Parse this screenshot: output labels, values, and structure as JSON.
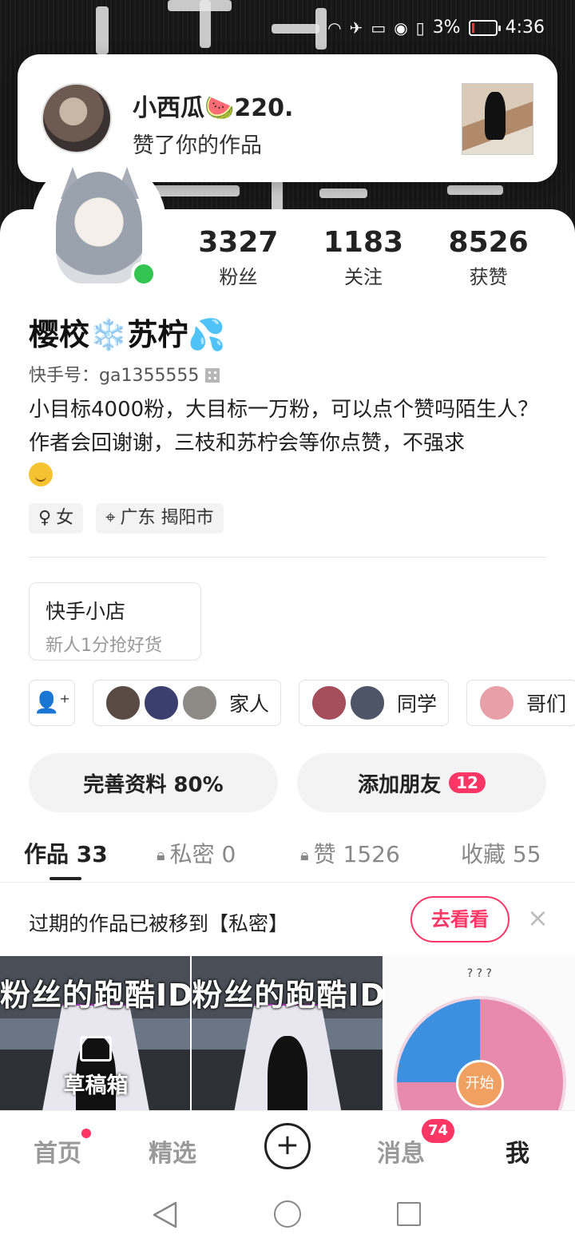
{
  "status": {
    "battery_percent": "3%",
    "time": "4:36"
  },
  "notification": {
    "user_name": "小西瓜🍉220.",
    "action": "赞了你的作品"
  },
  "stats": [
    {
      "value": "3327",
      "label": "粉丝"
    },
    {
      "value": "1183",
      "label": "关注"
    },
    {
      "value": "8526",
      "label": "获赞"
    }
  ],
  "profile": {
    "nickname": "樱校❄️苏柠💦",
    "kuaishou_id": "快手号：ga1355555",
    "bio": "小目标4000粉，大目标一万粉，可以点个赞吗陌生人？作者会回谢谢，三枝和苏柠会等你点赞，不强求",
    "tags": [
      {
        "icon": "female-icon",
        "text": "女"
      },
      {
        "icon": "location-icon",
        "text": "广东 揭阳市"
      }
    ]
  },
  "shop": {
    "title": "快手小店",
    "subtitle": "新人1分抢好货"
  },
  "groups": [
    {
      "label": "家人",
      "avatars": [
        "#5a4a44",
        "#3b3f6e",
        "#8d8a86"
      ]
    },
    {
      "label": "同学",
      "avatars": [
        "#a64d5c",
        "#4d5566"
      ]
    },
    {
      "label": "哥们",
      "avatars": [
        "#e8a0a8"
      ]
    }
  ],
  "buttons": {
    "complete_profile": "完善资料 80%",
    "add_friends": "添加朋友",
    "add_friends_badge": "12"
  },
  "tabs": {
    "works": "作品 33",
    "private": "私密 0",
    "likes": "赞 1526",
    "favorites": "收藏 55"
  },
  "notice": {
    "text": "过期的作品已被移到【私密】",
    "button": "去看看",
    "close": "×"
  },
  "grid": {
    "caption": "粉丝的跑酷ID在",
    "draft_label": "草稿箱",
    "wheel_title": "? ? ?",
    "wheel_button": "开始"
  },
  "bottom_nav": {
    "home": "首页",
    "featured": "精选",
    "plus": "+",
    "messages": "消息",
    "messages_badge": "74",
    "me": "我"
  },
  "colors": {
    "accent": "#fe3666",
    "online": "#33c451"
  }
}
